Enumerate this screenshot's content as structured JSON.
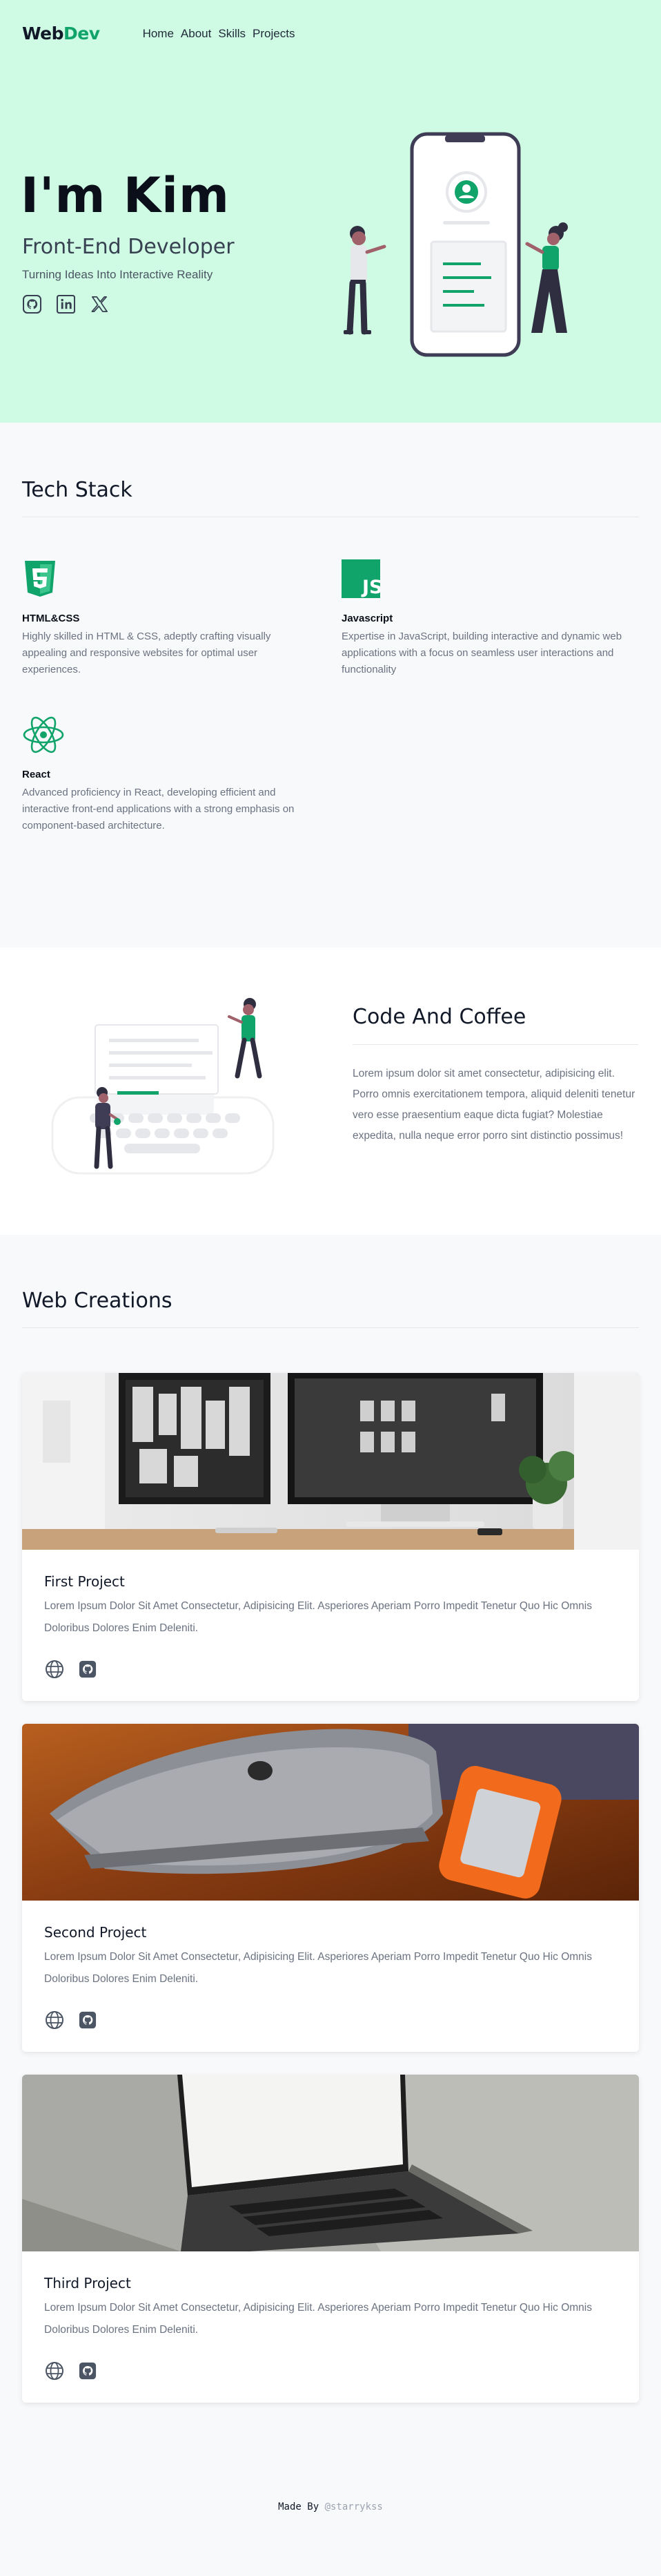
{
  "nav": {
    "logo_part1": "Web",
    "logo_part2": "Dev",
    "links": [
      "Home",
      "About",
      "Skills",
      "Projects"
    ]
  },
  "hero": {
    "name": "I'm Kim",
    "role": "Front-End Developer",
    "tagline": "Turning Ideas Into Interactive Reality",
    "social_icons": [
      "github-icon",
      "linkedin-icon",
      "x-icon"
    ]
  },
  "tech_stack": {
    "title": "Tech Stack",
    "items": [
      {
        "icon": "html5-icon",
        "name": "HTML&CSS",
        "desc": "Highly skilled in HTML & CSS, adeptly crafting visually appealing and responsive websites for optimal user experiences."
      },
      {
        "icon": "javascript-icon",
        "name": "Javascript",
        "desc": "Expertise in JavaScript, building interactive and dynamic web applications with a focus on seamless user interactions and functionality"
      },
      {
        "icon": "react-icon",
        "name": "React",
        "desc": "Advanced proficiency in React, developing efficient and interactive front-end applications with a strong emphasis on component-based architecture."
      }
    ]
  },
  "about": {
    "title": "Code And Coffee",
    "text": "Lorem ipsum dolor sit amet consectetur, adipisicing elit. Porro omnis exercitationem tempora, aliquid deleniti tenetur vero esse praesentium eaque dicta fugiat? Molestiae expedita, nulla neque error porro sint distinctio possimus!"
  },
  "projects": {
    "title": "Web Creations",
    "items": [
      {
        "title": "First Project",
        "desc": "Lorem Ipsum Dolor Sit Amet Consectetur, Adipisicing Elit. Asperiores Aperiam Porro Impedit Tenetur Quo Hic Omnis Doloribus Dolores Enim Deleniti."
      },
      {
        "title": "Second Project",
        "desc": "Lorem Ipsum Dolor Sit Amet Consectetur, Adipisicing Elit. Asperiores Aperiam Porro Impedit Tenetur Quo Hic Omnis Doloribus Dolores Enim Deleniti."
      },
      {
        "title": "Third Project",
        "desc": "Lorem Ipsum Dolor Sit Amet Consectetur, Adipisicing Elit. Asperiores Aperiam Porro Impedit Tenetur Quo Hic Omnis Doloribus Dolores Enim Deleniti."
      }
    ]
  },
  "footer": {
    "prefix": "Made By ",
    "handle": "@starrykss"
  },
  "colors": {
    "hero_bg": "#cffbe4",
    "accent": "#10a36a",
    "page_bg": "#f8f9fb"
  }
}
